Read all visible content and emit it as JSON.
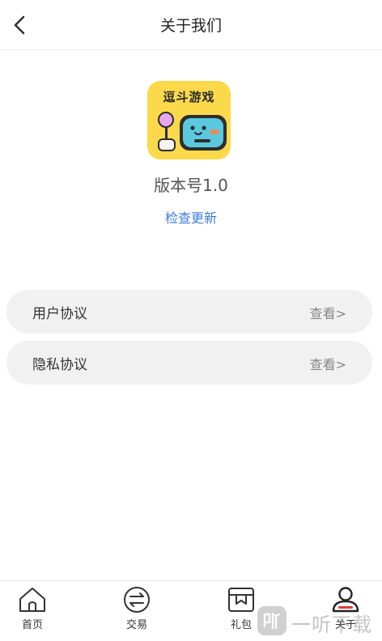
{
  "header": {
    "title": "关于我们",
    "back_icon": "chevron-left-icon"
  },
  "app": {
    "logo_text": "逗斗游戏",
    "logo_bg": "#fbd94a",
    "version": "版本号1.0",
    "check_update": "检查更新"
  },
  "menu": [
    {
      "label": "用户协议",
      "action": "查看>"
    },
    {
      "label": "隐私协议",
      "action": "查看>"
    }
  ],
  "tabs": [
    {
      "label": "首页",
      "icon": "home-icon"
    },
    {
      "label": "交易",
      "icon": "exchange-icon"
    },
    {
      "label": "礼包",
      "icon": "gift-icon"
    },
    {
      "label": "关于",
      "icon": "user-icon",
      "active": true
    }
  ],
  "watermark": {
    "text": "一听下载"
  },
  "colors": {
    "link": "#3d7ae0",
    "row_bg": "#f1f1f1",
    "active_accent": "#e33b3b"
  }
}
